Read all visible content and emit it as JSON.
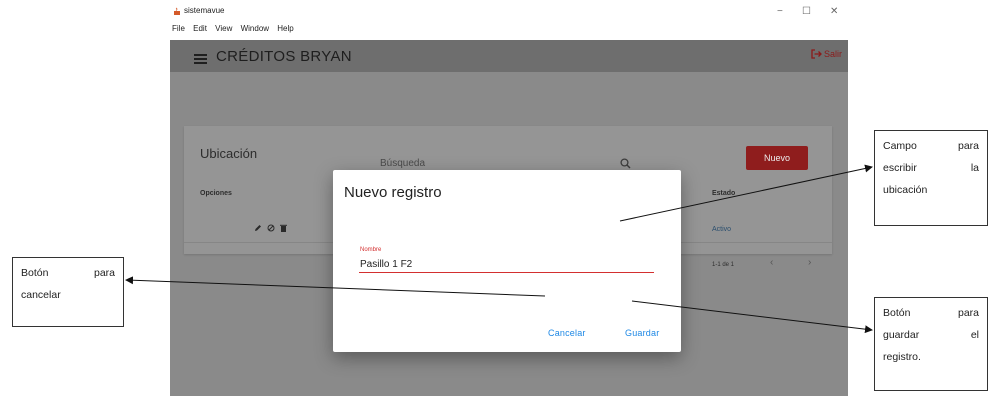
{
  "window": {
    "title": "sistemavue",
    "controls": {
      "minimize": "−",
      "maximize": "☐",
      "close": "✕"
    }
  },
  "menubar": {
    "items": [
      "File",
      "Edit",
      "View",
      "Window",
      "Help"
    ]
  },
  "header": {
    "title": "CRÉDITOS BRYAN",
    "logout_label": "Salir"
  },
  "card": {
    "title": "Ubicación",
    "search_placeholder": "Búsqueda",
    "new_button": "Nuevo",
    "columns": {
      "options": "Opciones",
      "status": "Estado"
    },
    "row": {
      "status": "Activo"
    },
    "pagination": {
      "range": "1-1 de 1",
      "prev": "‹",
      "next": "›"
    }
  },
  "dialog": {
    "title": "Nuevo registro",
    "field_label": "Nombre",
    "field_value": "Pasillo 1 F2",
    "cancel_label": "Cancelar",
    "save_label": "Guardar"
  },
  "annotations": {
    "left": {
      "line1": "Botón para",
      "line2": "cancelar"
    },
    "right_top": {
      "line1": "Campo para",
      "line2": "escribir la",
      "line3": "ubicación"
    },
    "right_bottom": {
      "line1": "Botón para",
      "line2": "guardar el",
      "line3": "registro."
    }
  },
  "colors": {
    "accent_red": "#d32f2f",
    "link_blue": "#1e88e5",
    "overlay_gray": "#8a8a8a"
  }
}
